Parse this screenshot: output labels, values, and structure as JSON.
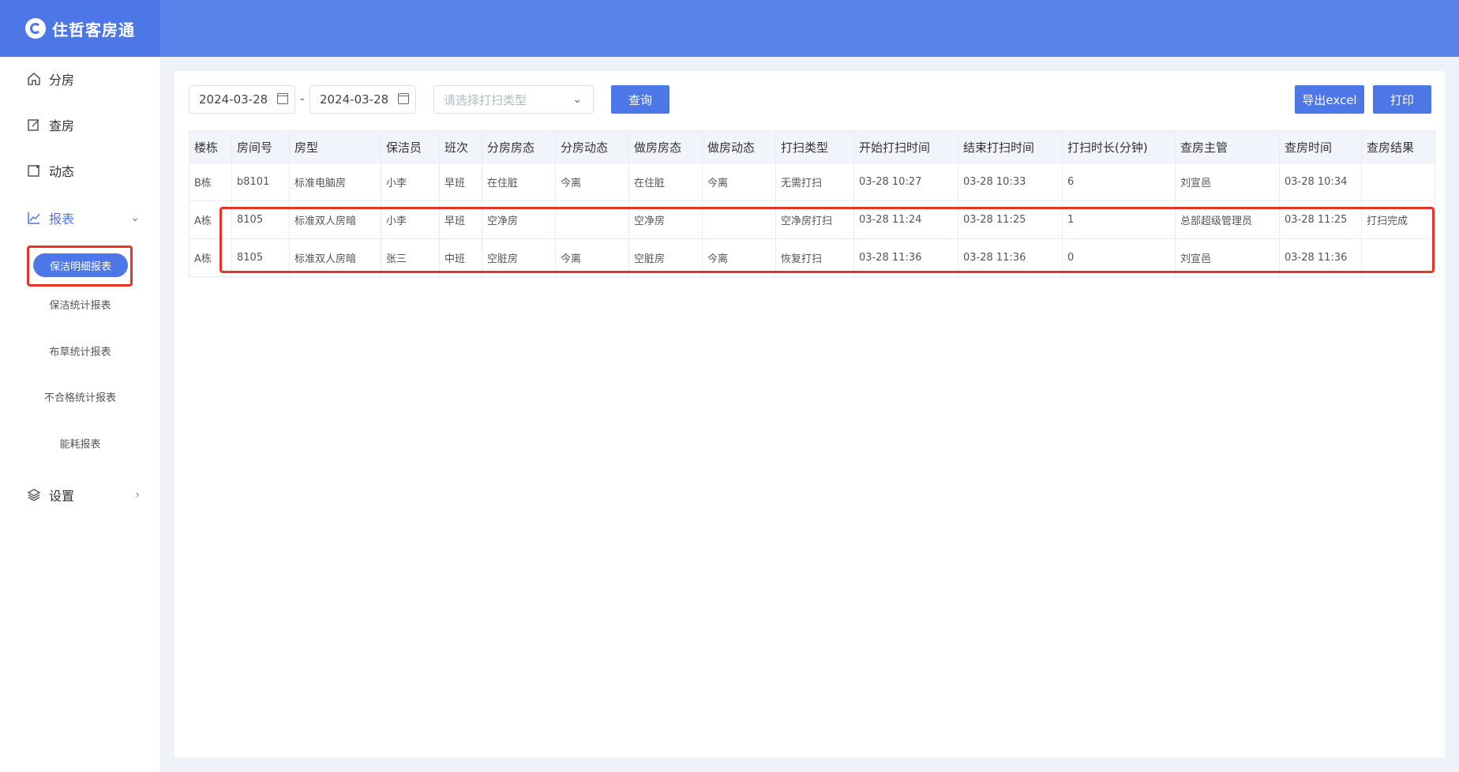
{
  "app": {
    "title": "住哲客房通"
  },
  "sidebar": {
    "items": [
      {
        "label": "分房",
        "icon": "home-icon"
      },
      {
        "label": "查房",
        "icon": "edit-icon"
      },
      {
        "label": "动态",
        "icon": "dynamic-icon"
      },
      {
        "label": "报表",
        "icon": "chart-icon"
      },
      {
        "label": "设置",
        "icon": "layers-icon"
      }
    ],
    "report_sub": [
      {
        "label": "保洁明细报表"
      },
      {
        "label": "保洁统计报表"
      },
      {
        "label": "布草统计报表"
      },
      {
        "label": "不合格统计报表"
      },
      {
        "label": "能耗报表"
      }
    ]
  },
  "filters": {
    "start_date": "2024-03-28",
    "end_date": "2024-03-28",
    "separator": "-",
    "clean_type_placeholder": "请选择打扫类型",
    "query_label": "查询",
    "export_label": "导出excel",
    "print_label": "打印"
  },
  "table": {
    "headers": [
      "楼栋",
      "房间号",
      "房型",
      "保洁员",
      "班次",
      "分房房态",
      "分房动态",
      "做房房态",
      "做房动态",
      "打扫类型",
      "开始打扫时间",
      "结束打扫时间",
      "打扫时长(分钟)",
      "查房主管",
      "查房时间",
      "查房结果"
    ],
    "rows": [
      [
        "B栋",
        "b8101",
        "标准电脑房",
        "小李",
        "早班",
        "在住脏",
        "今离",
        "在住脏",
        "今离",
        "无需打扫",
        "03-28 10:27",
        "03-28 10:33",
        "6",
        "刘宣邑",
        "03-28 10:34",
        ""
      ],
      [
        "A栋",
        "8105",
        "标准双人房暗",
        "小李",
        "早班",
        "空净房",
        "",
        "空净房",
        "",
        "空净房打扫",
        "03-28 11:24",
        "03-28 11:25",
        "1",
        "总部超级管理员",
        "03-28 11:25",
        "打扫完成"
      ],
      [
        "A栋",
        "8105",
        "标准双人房暗",
        "张三",
        "中班",
        "空脏房",
        "今离",
        "空脏房",
        "今离",
        "恢复打扫",
        "03-28 11:36",
        "03-28 11:36",
        "0",
        "刘宣邑",
        "03-28 11:36",
        ""
      ]
    ]
  },
  "colors": {
    "primary": "#4d76e6",
    "topbar": "#5b82ea",
    "highlight": "#e8332a"
  }
}
